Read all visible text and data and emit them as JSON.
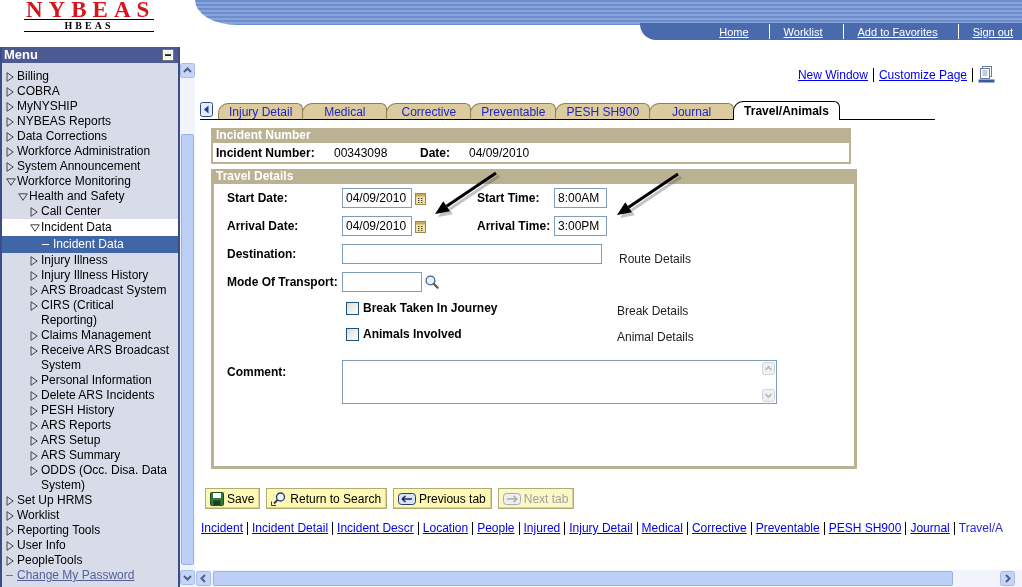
{
  "header": {
    "logo": {
      "title": "NYBEAS",
      "subtitle": "HBEAS"
    },
    "nav_links": [
      "Home",
      "Worklist",
      "Add to Favorites",
      "Sign out"
    ]
  },
  "menu": {
    "title": "Menu",
    "items": [
      {
        "label": "Billing",
        "kind": "folder",
        "expanded": false,
        "selected": false,
        "highlighted": false
      },
      {
        "label": "COBRA",
        "kind": "folder",
        "expanded": false,
        "selected": false,
        "highlighted": false
      },
      {
        "label": "MyNYSHIP",
        "kind": "folder",
        "expanded": false,
        "selected": false,
        "highlighted": false
      },
      {
        "label": "NYBEAS Reports",
        "kind": "folder",
        "expanded": false,
        "selected": false,
        "highlighted": false
      },
      {
        "label": "Data Corrections",
        "kind": "folder",
        "expanded": false,
        "selected": false,
        "highlighted": false
      },
      {
        "label": "Workforce Administration",
        "kind": "folder",
        "expanded": false,
        "selected": false,
        "highlighted": false
      },
      {
        "label": "System Announcement",
        "kind": "folder",
        "expanded": false,
        "selected": false,
        "highlighted": false
      },
      {
        "label": "Workforce Monitoring",
        "kind": "folder",
        "expanded": true,
        "selected": false,
        "highlighted": false,
        "children": [
          {
            "label": "Health and Safety",
            "kind": "folder",
            "expanded": true,
            "selected": false,
            "highlighted": false,
            "children": [
              {
                "label": "Call Center",
                "kind": "folder",
                "expanded": false,
                "selected": false,
                "highlighted": false
              },
              {
                "label": "Incident Data",
                "kind": "folder",
                "expanded": true,
                "selected": false,
                "highlighted": true,
                "children": [
                  {
                    "label": "Incident Data",
                    "kind": "leaf",
                    "selected": true,
                    "highlighted": false
                  }
                ]
              },
              {
                "label": "Injury Illness",
                "kind": "folder",
                "expanded": false,
                "selected": false,
                "highlighted": false
              },
              {
                "label": "Injury Illness History",
                "kind": "folder",
                "expanded": false,
                "selected": false,
                "highlighted": false
              },
              {
                "label": "ARS Broadcast System",
                "kind": "folder",
                "expanded": false,
                "selected": false,
                "highlighted": false
              },
              {
                "label": "CIRS (Critical Reporting)",
                "kind": "folder",
                "expanded": false,
                "selected": false,
                "highlighted": false
              },
              {
                "label": "Claims Management",
                "kind": "folder",
                "expanded": false,
                "selected": false,
                "highlighted": false
              },
              {
                "label": "Receive ARS Broadcast System",
                "kind": "folder",
                "expanded": false,
                "selected": false,
                "highlighted": false
              },
              {
                "label": "Personal Information",
                "kind": "folder",
                "expanded": false,
                "selected": false,
                "highlighted": false
              },
              {
                "label": "Delete ARS Incidents",
                "kind": "folder",
                "expanded": false,
                "selected": false,
                "highlighted": false
              },
              {
                "label": "PESH History",
                "kind": "folder",
                "expanded": false,
                "selected": false,
                "highlighted": false
              },
              {
                "label": "ARS Reports",
                "kind": "folder",
                "expanded": false,
                "selected": false,
                "highlighted": false
              },
              {
                "label": "ARS Setup",
                "kind": "folder",
                "expanded": false,
                "selected": false,
                "highlighted": false
              },
              {
                "label": "ARS Summary",
                "kind": "folder",
                "expanded": false,
                "selected": false,
                "highlighted": false
              },
              {
                "label": "ODDS (Occ. Disa. Data System)",
                "kind": "folder",
                "expanded": false,
                "selected": false,
                "highlighted": false
              }
            ]
          }
        ]
      },
      {
        "label": "Set Up HRMS",
        "kind": "folder",
        "expanded": false,
        "selected": false,
        "highlighted": false
      },
      {
        "label": "Worklist",
        "kind": "folder",
        "expanded": false,
        "selected": false,
        "highlighted": false
      },
      {
        "label": "Reporting Tools",
        "kind": "folder",
        "expanded": false,
        "selected": false,
        "highlighted": false
      },
      {
        "label": "User Info",
        "kind": "folder",
        "expanded": false,
        "selected": false,
        "highlighted": false
      },
      {
        "label": "PeopleTools",
        "kind": "folder",
        "expanded": false,
        "selected": false,
        "highlighted": false
      },
      {
        "label": "Change My Password",
        "kind": "link",
        "selected": false,
        "highlighted": false
      }
    ]
  },
  "page_links": [
    "New Window",
    "Customize Page"
  ],
  "tabs": [
    {
      "label": "Injury Detail",
      "selected": false
    },
    {
      "label": "Medical",
      "selected": false
    },
    {
      "label": "Corrective",
      "selected": false
    },
    {
      "label": "Preventable",
      "selected": false
    },
    {
      "label": "PESH SH900",
      "selected": false
    },
    {
      "label": "Journal",
      "selected": false
    },
    {
      "label": "Travel/Animals",
      "selected": true
    }
  ],
  "incident": {
    "title": "Incident Number",
    "fields": [
      {
        "label": "Incident Number:",
        "value": "00343098"
      },
      {
        "label": "Date:",
        "value": "04/09/2010"
      }
    ]
  },
  "travel": {
    "title": "Travel Details",
    "date_rows": [
      {
        "date": {
          "label": "Start Date:",
          "value": "04/09/2010",
          "pointer_arrow": false
        },
        "time": {
          "label": "Start Time:",
          "value": "8:00AM",
          "pointer_arrow": false
        }
      },
      {
        "date": {
          "label": "Arrival Date:",
          "value": "04/09/2010",
          "pointer_arrow": true
        },
        "time": {
          "label": "Arrival Time:",
          "value": "3:00PM",
          "pointer_arrow": true
        }
      }
    ],
    "destination": {
      "label": "Destination:",
      "details": "Route Details"
    },
    "mode_of_transport": {
      "label": "Mode Of Transport:"
    },
    "checkboxes": [
      {
        "label": "Break Taken In Journey",
        "checked": false,
        "details": "Break Details"
      },
      {
        "label": "Animals Involved",
        "checked": false,
        "details": "Animal Details"
      }
    ],
    "comment": {
      "label": "Comment:"
    }
  },
  "buttons": [
    {
      "label": "Save",
      "kind": "save",
      "disabled": false
    },
    {
      "label": "Return to Search",
      "kind": "search",
      "disabled": false
    },
    {
      "label": "Previous tab",
      "kind": "previous",
      "disabled": false
    },
    {
      "label": "Next tab",
      "kind": "next",
      "disabled": true
    }
  ],
  "footer_links": [
    {
      "label": "Incident",
      "selected": false
    },
    {
      "label": "Incident Detail",
      "selected": false
    },
    {
      "label": "Incident Descr",
      "selected": false
    },
    {
      "label": "Location",
      "selected": false
    },
    {
      "label": "People",
      "selected": false
    },
    {
      "label": "Injured",
      "selected": false
    },
    {
      "label": "Injury Detail",
      "selected": false
    },
    {
      "label": "Medical",
      "selected": false
    },
    {
      "label": "Corrective",
      "selected": false
    },
    {
      "label": "Preventable",
      "selected": false
    },
    {
      "label": "PESH SH900",
      "selected": false
    },
    {
      "label": "Journal",
      "selected": false
    },
    {
      "label": "Travel/A",
      "selected": true
    }
  ]
}
